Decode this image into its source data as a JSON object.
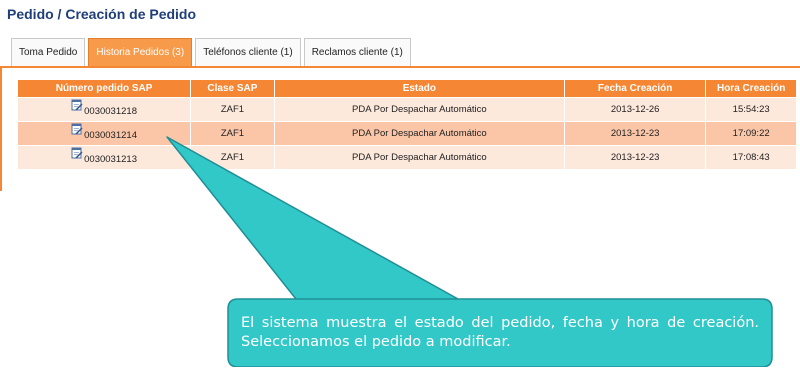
{
  "page": {
    "title": "Pedido / Creación de Pedido"
  },
  "tabs": [
    {
      "label": "Toma Pedido",
      "active": false
    },
    {
      "label": "Historia Pedidos (3)",
      "active": true
    },
    {
      "label": "Teléfonos cliente (1)",
      "active": false
    },
    {
      "label": "Reclamos cliente (1)",
      "active": false
    }
  ],
  "table": {
    "columns": [
      "Número pedido SAP",
      "Clase SAP",
      "Estado",
      "Fecha Creación",
      "Hora Creación"
    ],
    "rows": [
      {
        "order": "0030031218",
        "clase": "ZAF1",
        "estado": "PDA Por Despachar Automático",
        "fecha": "2013-12-26",
        "hora": "15:54:23"
      },
      {
        "order": "0030031214",
        "clase": "ZAF1",
        "estado": "PDA Por Despachar Automático",
        "fecha": "2013-12-23",
        "hora": "17:09:22"
      },
      {
        "order": "0030031213",
        "clase": "ZAF1",
        "estado": "PDA Por Despachar Automático",
        "fecha": "2013-12-23",
        "hora": "17:08:43"
      }
    ]
  },
  "callout": {
    "text": "El sistema muestra el estado del pedido, fecha y hora de creación. Seleccionamos el pedido a modificar.",
    "fill": "#33c8c8",
    "border": "#1f8f96"
  },
  "colors": {
    "accent": "#f48634",
    "title": "#1f3f7a",
    "row_light": "#fde8dc",
    "row_selected": "#fbc6a8"
  },
  "icons": {
    "order_link": "edit-document-icon"
  }
}
